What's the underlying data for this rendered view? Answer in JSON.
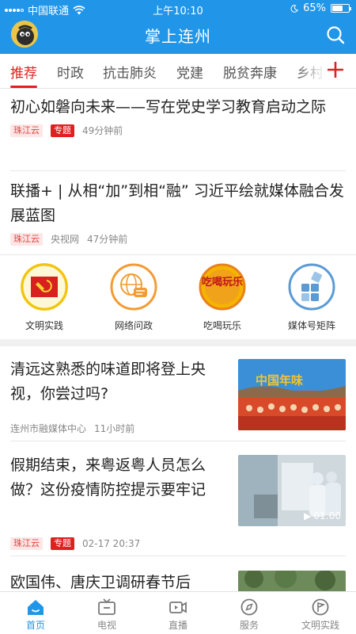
{
  "status_bar": {
    "carrier": "中国联通",
    "time": "上午10:10",
    "battery": "65%",
    "battery_level": 0.65
  },
  "header": {
    "title": "掌上连州"
  },
  "tabs": [
    {
      "label": "推荐",
      "active": true
    },
    {
      "label": "时政"
    },
    {
      "label": "抗击肺炎"
    },
    {
      "label": "党建"
    },
    {
      "label": "脱贫奔康"
    },
    {
      "label": "乡村"
    }
  ],
  "news": [
    {
      "headline": "初心如磐向未来——写在党史学习教育启动之际",
      "source": "珠江云",
      "tag": "专题",
      "time": "49分钟前"
    },
    {
      "headline": "联播+ | 从相“加”到相“融” 习近平绘就媒体融合发展蓝图",
      "source": "珠江云",
      "origin": "央视网",
      "time": "47分钟前"
    }
  ],
  "quick_links": [
    {
      "label": "文明实践",
      "icon": "party-flag-icon"
    },
    {
      "label": "网络问政",
      "icon": "globe-chat-icon"
    },
    {
      "label": "吃喝玩乐",
      "icon": "food-fun-icon",
      "badge_text": "吃喝玩乐"
    },
    {
      "label": "媒体号矩阵",
      "icon": "matrix-icon"
    }
  ],
  "image_news": [
    {
      "headline": "清远这熟悉的味道即将登上央视，你尝过吗?",
      "source": "连州市融媒体中心",
      "time": "11小时前",
      "image_text": "中国年味"
    },
    {
      "headline": "假期结束，来粤返粤人员怎么做？这份疫情防控提示要牢记",
      "source": "珠江云",
      "tag": "专题",
      "time": "02-17 20:37",
      "duration": "01:00"
    },
    {
      "headline": "欧国伟、唐庆卫调研春节后"
    }
  ],
  "bottom_nav": [
    {
      "label": "首页",
      "icon": "home-icon",
      "active": true
    },
    {
      "label": "电视",
      "icon": "tv-icon"
    },
    {
      "label": "直播",
      "icon": "live-video-icon"
    },
    {
      "label": "服务",
      "icon": "compass-icon"
    },
    {
      "label": "文明实践",
      "icon": "flag-circle-icon"
    }
  ],
  "colors": {
    "brand_blue": "#2196e8",
    "accent_red": "#e02020"
  }
}
